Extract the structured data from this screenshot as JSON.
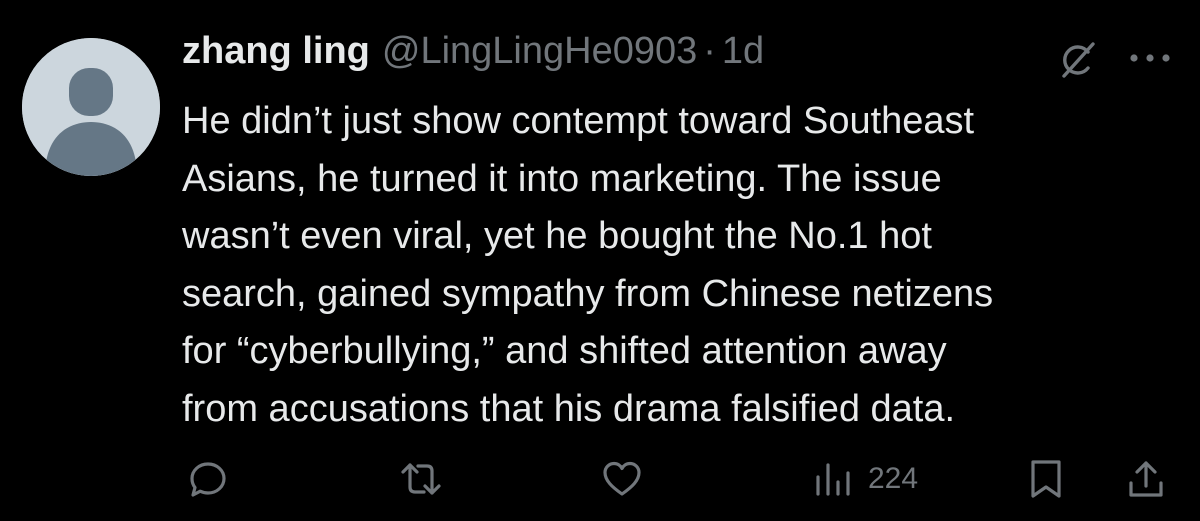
{
  "tweet": {
    "author": {
      "display_name": "zhang ling",
      "handle": "@LingLingHe0903",
      "separator": "·",
      "time": "1d"
    },
    "text_lines": [
      "He didn’t just show contempt toward Southeast",
      "Asians, he turned it into marketing. The issue",
      "wasn’t even viral, yet he bought the No.1 hot",
      "search, gained sympathy from Chinese netizens",
      "for “cyberbullying,” and shifted attention away",
      "from accusations that his drama falsified data."
    ],
    "icons": {
      "top_right": [
        "grok-icon",
        "more-icon"
      ],
      "actions": [
        "reply-icon",
        "retweet-icon",
        "like-icon",
        "views-icon",
        "bookmark-icon",
        "share-icon"
      ]
    },
    "views": "224",
    "colors": {
      "background": "#000000",
      "text": "#e7e9ea",
      "secondary": "#71767b",
      "avatar_bg": "#ccd6dd",
      "avatar_fg": "#657786"
    }
  }
}
